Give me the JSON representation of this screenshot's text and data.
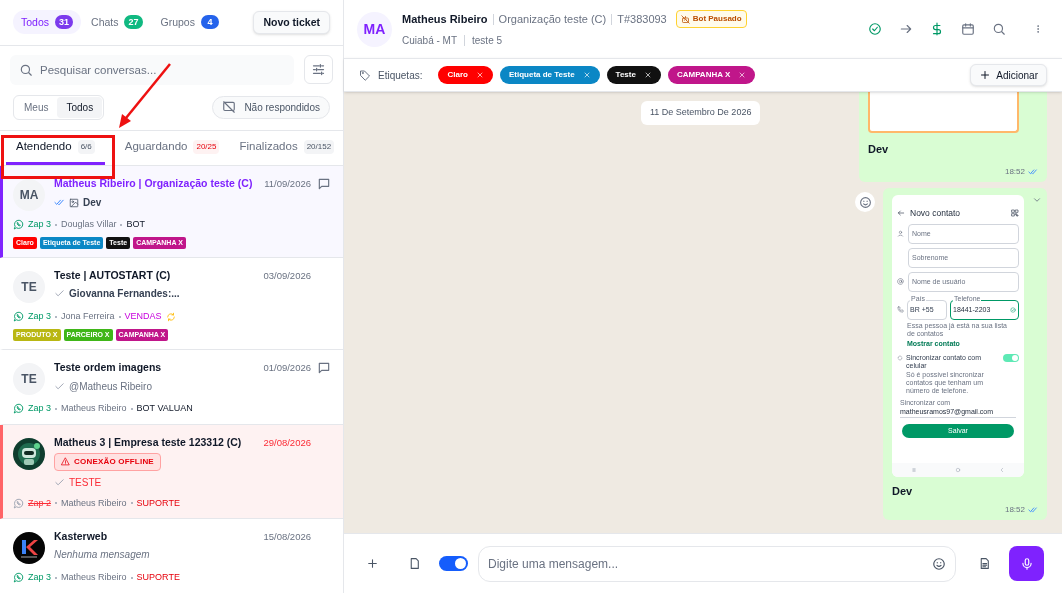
{
  "filters": [
    {
      "label": "Todos",
      "count": "31",
      "color": "#7c3aed",
      "selected": true
    },
    {
      "label": "Chats",
      "count": "27",
      "color": "#10b981",
      "selected": false
    },
    {
      "label": "Grupos",
      "count": "4",
      "color": "#2563eb",
      "selected": false
    }
  ],
  "new_ticket_button": "Novo ticket",
  "search": {
    "placeholder": "Pesquisar conversas..."
  },
  "scope": [
    {
      "label": "Meus",
      "selected": false
    },
    {
      "label": "Todos",
      "selected": true
    }
  ],
  "unanswered_button": "Não respondidos",
  "tabs": [
    {
      "label": "Atendendo",
      "count": "6/6",
      "alert": false,
      "selected": true
    },
    {
      "label": "Aguardando",
      "count": "20/25",
      "alert": true,
      "selected": false
    },
    {
      "label": "Finalizados",
      "count": "20/152",
      "alert": false,
      "selected": false
    }
  ],
  "tickets": [
    {
      "avatar": {
        "kind": "initials",
        "text": "MA"
      },
      "title": "Matheus Ribeiro | Organização teste (C)",
      "date": "11/09/2026",
      "selected": true,
      "offline": false,
      "comment_icon": true,
      "delivered": true,
      "read": true,
      "image_icon": true,
      "preview": "Dev",
      "unread": true,
      "empty": false,
      "channel": "Zap 3",
      "agent": "Douglas Villar",
      "queue": {
        "label": "BOT",
        "kind": "plain"
      },
      "queue_syncing": false,
      "tags": [
        {
          "label": "Claro",
          "color": "#ff0000"
        },
        {
          "label": "Etiqueta de Teste",
          "color": "#0b87c5"
        },
        {
          "label": "Teste",
          "color": "#111111"
        },
        {
          "label": "CAMPANHA X",
          "color": "#c0168a"
        }
      ]
    },
    {
      "avatar": {
        "kind": "initials",
        "text": "TE"
      },
      "title": "Teste | AUTOSTART (C)",
      "date": "03/09/2026",
      "selected": false,
      "offline": false,
      "comment_icon": false,
      "delivered": true,
      "read": false,
      "image_icon": false,
      "preview": "Giovanna Fernandes:...",
      "unread": true,
      "empty": false,
      "channel": "Zap 3",
      "agent": "Jona Ferreira",
      "queue": {
        "label": "VENDAS",
        "kind": "sales"
      },
      "queue_syncing": true,
      "tags": [
        {
          "label": "PRODUTO X",
          "color": "#b9b713"
        },
        {
          "label": "PARCEIRO X",
          "color": "#3fb618"
        },
        {
          "label": "CAMPANHA X",
          "color": "#c0168a"
        }
      ]
    },
    {
      "avatar": {
        "kind": "initials",
        "text": "TE"
      },
      "title": "Teste ordem imagens",
      "date": "01/09/2026",
      "selected": false,
      "offline": false,
      "comment_icon": true,
      "delivered": true,
      "read": false,
      "image_icon": false,
      "preview": "@Matheus Ribeiro",
      "unread": false,
      "empty": false,
      "channel": "Zap 3",
      "agent": "Matheus Ribeiro",
      "queue": {
        "label": "BOT VALUAN",
        "kind": "plain"
      },
      "queue_syncing": false
    },
    {
      "avatar": {
        "kind": "robot"
      },
      "title": "Matheus 3 | Empresa teste 123312 (C)",
      "date": "29/08/2026",
      "selected": false,
      "offline": true,
      "offline_label": "CONEXÃO OFFLINE",
      "comment_icon": false,
      "delivered": true,
      "read": false,
      "image_icon": false,
      "preview": "TESTE",
      "unread": false,
      "empty": false,
      "channel": "Zap 2",
      "agent": "Matheus Ribeiro",
      "queue": {
        "label": "SUPORTE",
        "kind": "support"
      },
      "queue_syncing": false
    },
    {
      "avatar": {
        "kind": "logo"
      },
      "title": "Kasterweb",
      "date": "15/08/2026",
      "selected": false,
      "offline": false,
      "comment_icon": false,
      "delivered": false,
      "image_icon": false,
      "preview": "Nenhuma mensagem",
      "unread": false,
      "empty": true,
      "channel": "Zap 3",
      "agent": "Matheus Ribeiro",
      "queue": {
        "label": "SUPORTE",
        "kind": "support"
      },
      "queue_syncing": false
    }
  ],
  "header": {
    "avatar": "MA",
    "name": "Matheus Ribeiro",
    "organization": "Organização teste (C)",
    "ticket": "T#383093",
    "bot_badge": "Bot Pausado",
    "location": "Cuiabá - MT",
    "connection": "teste 5"
  },
  "tag_bar": {
    "label": "Etiquetas:",
    "tags": [
      {
        "label": "Claro",
        "color": "#ff0000"
      },
      {
        "label": "Etiqueta de Teste",
        "color": "#0b87c5"
      },
      {
        "label": "Teste",
        "color": "#111111"
      },
      {
        "label": "CAMPANHA X",
        "color": "#c0168a"
      }
    ],
    "add_button": "Adicionar"
  },
  "date_chip": "11 De Setembro De 2026",
  "messages": [
    {
      "kind": "cut-image",
      "caption": "Dev",
      "time": "18:52",
      "read": true
    },
    {
      "kind": "screenshot",
      "caption": "Dev",
      "time": "18:52",
      "read": true,
      "screenshot": {
        "title": "Novo contato",
        "fields": [
          {
            "placeholder": "Nome"
          },
          {
            "placeholder": "Sobrenome"
          },
          {
            "placeholder": "Nome de usuário"
          }
        ],
        "country_label": "País",
        "country": "BR +55",
        "phone_label": "Telefone",
        "phone": "18441-2203",
        "notice": "Essa pessoa já está na sua lista de contatos",
        "link": "Mostrar contato",
        "sync_title": "Sincronizar contato com celular",
        "sync_desc": "Só é possível sincronizar contatos que tenham um número de telefone.",
        "sync_on": true,
        "account_label": "Sincronizar com",
        "account": "matheusramos97@gmail.com",
        "save": "Salvar"
      }
    }
  ],
  "composer": {
    "signature_on": true,
    "placeholder": "Digite uma mensagem..."
  }
}
